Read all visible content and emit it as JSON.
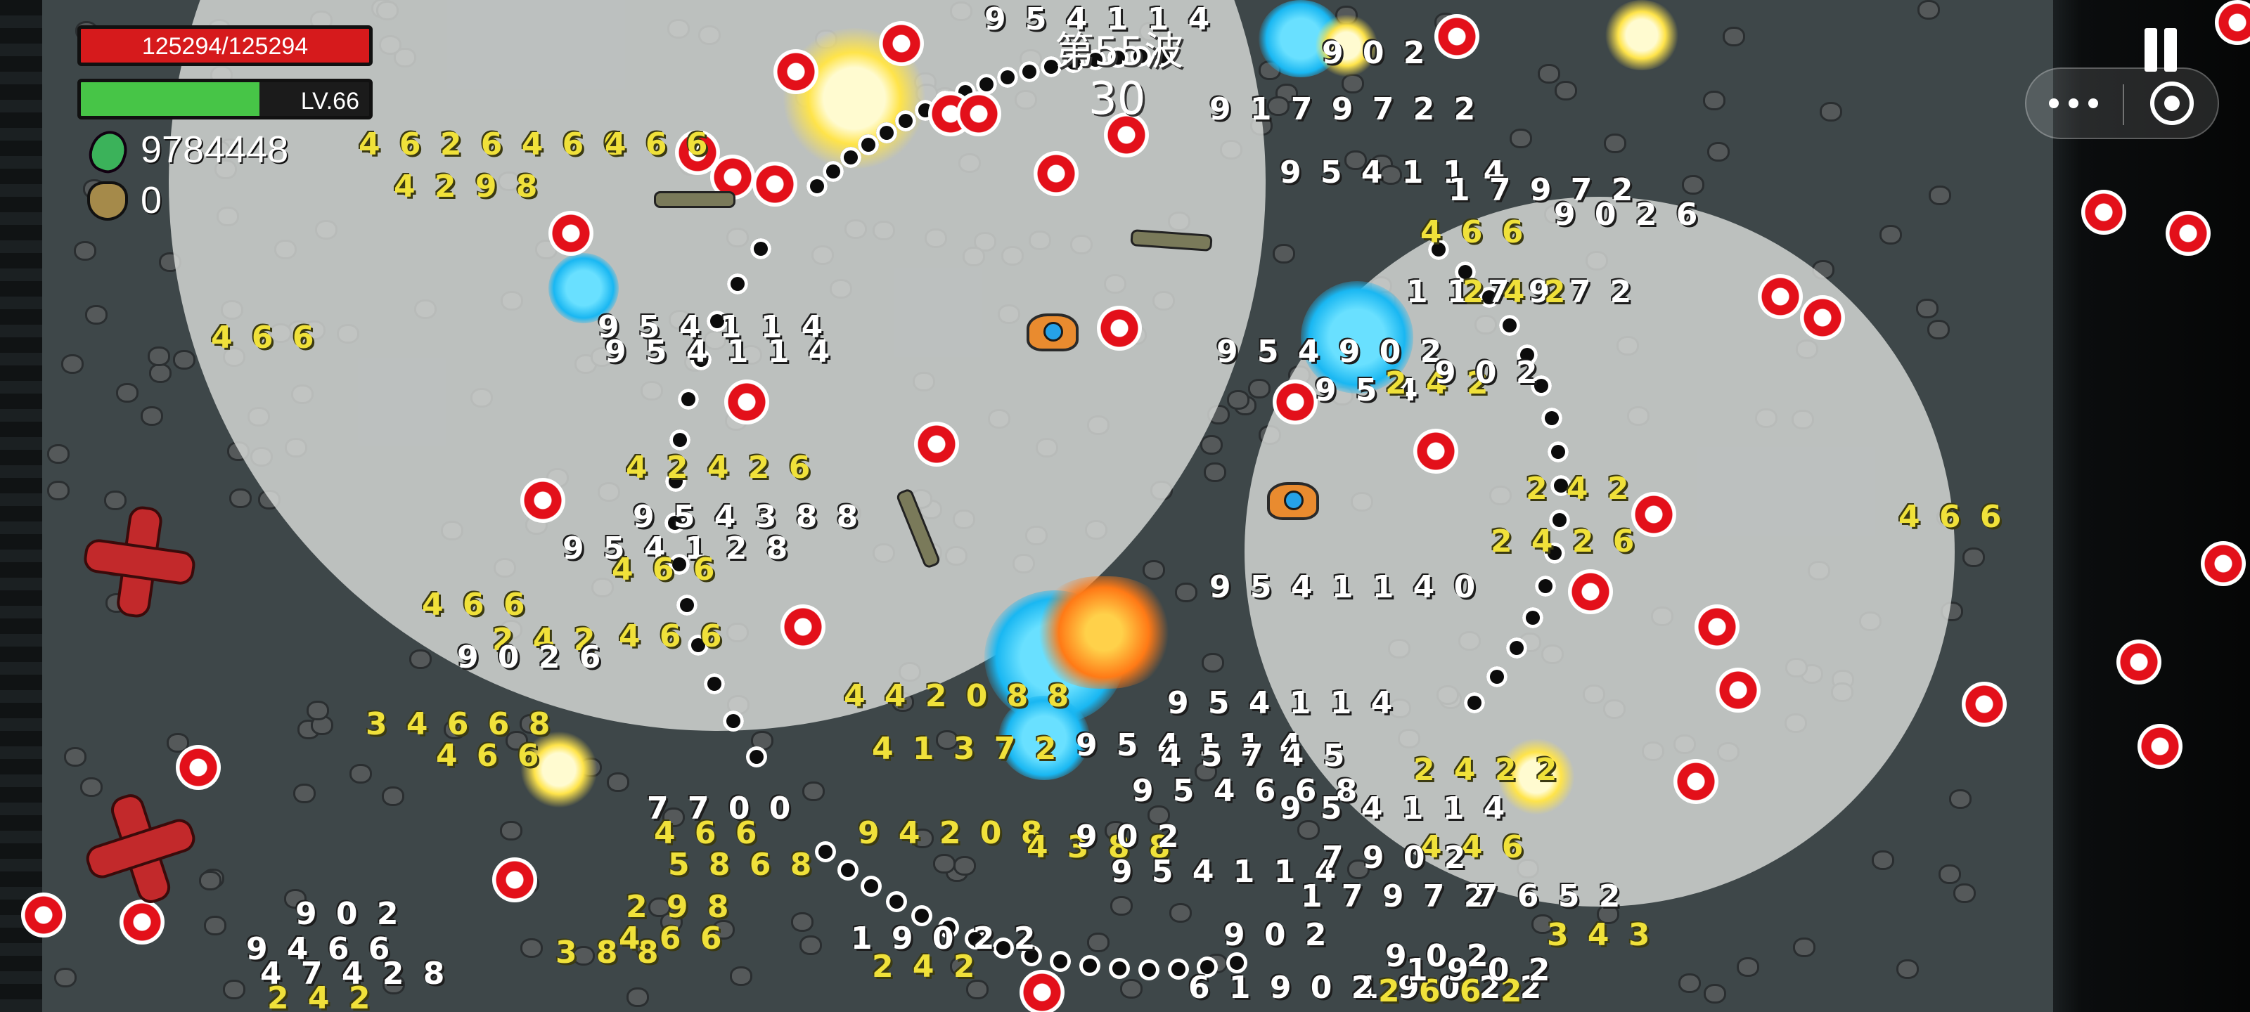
{
  "hud": {
    "hp_text": "125294/125294",
    "hp_fraction": 1.0,
    "level_text": "LV.66",
    "xp_fraction": 0.62,
    "gem_count": "9784448",
    "bag_count": "0",
    "wave_label": "第55波",
    "countdown": "30"
  },
  "icons": {
    "gem": "green-gem-icon",
    "bag": "money-bag-icon",
    "pause": "pause-icon",
    "more": "more-dots-icon",
    "close": "target-close-icon"
  },
  "colors": {
    "hp": "#d61a1c",
    "xp": "#47c547",
    "damage_yellow": "#f0e13a",
    "damage_white": "#ffffff",
    "enemy_orb": "#e3101a"
  },
  "damage_numbers": [
    {
      "text": "9 5 4 1 1 4",
      "c": "w"
    },
    {
      "text": "9 0 2",
      "c": "w"
    },
    {
      "text": "9 1 7 9 7 2 2",
      "c": "w"
    },
    {
      "text": "9 5 4 1 1 4",
      "c": "w"
    },
    {
      "text": "1 7 9 7 2",
      "c": "w"
    },
    {
      "text": "9 0 2 6",
      "c": "w"
    },
    {
      "text": "4 6 6",
      "c": "y"
    },
    {
      "text": "1 1 7 9 7 2",
      "c": "w"
    },
    {
      "text": "2 4 2",
      "c": "y"
    },
    {
      "text": "4 6 2 6 4 6 6",
      "c": "y"
    },
    {
      "text": "4 2 9 8",
      "c": "y"
    },
    {
      "text": "4 6 6",
      "c": "y"
    },
    {
      "text": "4 6 6",
      "c": "y"
    },
    {
      "text": "4 6 6",
      "c": "y"
    },
    {
      "text": "9 5 4 1 1 4",
      "c": "w"
    },
    {
      "text": "9 5 4 1 1 4",
      "c": "w"
    },
    {
      "text": "9 5 4 9 0 2",
      "c": "w"
    },
    {
      "text": "9 5 4",
      "c": "w"
    },
    {
      "text": "2 4 2",
      "c": "y"
    },
    {
      "text": "9 0 2",
      "c": "w"
    },
    {
      "text": "4 2 4 2 6",
      "c": "y"
    },
    {
      "text": "9 5 4 3 8 8",
      "c": "w"
    },
    {
      "text": "2 4 2",
      "c": "y"
    },
    {
      "text": "2 4 2 6",
      "c": "y"
    },
    {
      "text": "9 5 4 1 2 8",
      "c": "w"
    },
    {
      "text": "4 6 6",
      "c": "y"
    },
    {
      "text": "4 6 6",
      "c": "y"
    },
    {
      "text": "9 5 4 1 1 4 0",
      "c": "w"
    },
    {
      "text": "4 6 6",
      "c": "y"
    },
    {
      "text": "2 4 2",
      "c": "y"
    },
    {
      "text": "9 0 2 6",
      "c": "w"
    },
    {
      "text": "3 4 6 6 8",
      "c": "y"
    },
    {
      "text": "4 4 2 0 8 8",
      "c": "y"
    },
    {
      "text": "9 5 4 1 1 4",
      "c": "w"
    },
    {
      "text": "4 6 6",
      "c": "y"
    },
    {
      "text": "4 1 3 7 2",
      "c": "y"
    },
    {
      "text": "9 5 4 1 1 4",
      "c": "w"
    },
    {
      "text": "4 5 7 4 5",
      "c": "w"
    },
    {
      "text": "2 4 2 2",
      "c": "y"
    },
    {
      "text": "9 5 4 6 6 8",
      "c": "w"
    },
    {
      "text": "9 5 4 1 1 4",
      "c": "w"
    },
    {
      "text": "7 7 0 0",
      "c": "w"
    },
    {
      "text": "4 6 6",
      "c": "y"
    },
    {
      "text": "5 8 6 8",
      "c": "y"
    },
    {
      "text": "9 4 2 0 8",
      "c": "y"
    },
    {
      "text": "4 3 8 8",
      "c": "y"
    },
    {
      "text": "9 0 2",
      "c": "w"
    },
    {
      "text": "4 4 6",
      "c": "y"
    },
    {
      "text": "9 5 4 1 1 4",
      "c": "w"
    },
    {
      "text": "7 9 0 2",
      "c": "w"
    },
    {
      "text": "1 7 9 7 2",
      "c": "w"
    },
    {
      "text": "7 6 5 2",
      "c": "w"
    },
    {
      "text": "9 0 2",
      "c": "w"
    },
    {
      "text": "3 4 3",
      "c": "y"
    },
    {
      "text": "9 0 2",
      "c": "w"
    },
    {
      "text": "2 9 8",
      "c": "y"
    },
    {
      "text": "9 4 6 6",
      "c": "w"
    },
    {
      "text": "3 8 8",
      "c": "y"
    },
    {
      "text": "4 6 6",
      "c": "y"
    },
    {
      "text": "1 9 0 2 2",
      "c": "w"
    },
    {
      "text": "9 0 2",
      "c": "w"
    },
    {
      "text": "4 7 4 2 8",
      "c": "w"
    },
    {
      "text": "2 4 2",
      "c": "y"
    },
    {
      "text": "1 9 0 2 2",
      "c": "w"
    },
    {
      "text": "2 6 6 2",
      "c": "y"
    },
    {
      "text": "6 1 9 0 2",
      "c": "w"
    },
    {
      "text": "2 4 2",
      "c": "y"
    },
    {
      "text": "1 9 0 2",
      "c": "w"
    }
  ]
}
